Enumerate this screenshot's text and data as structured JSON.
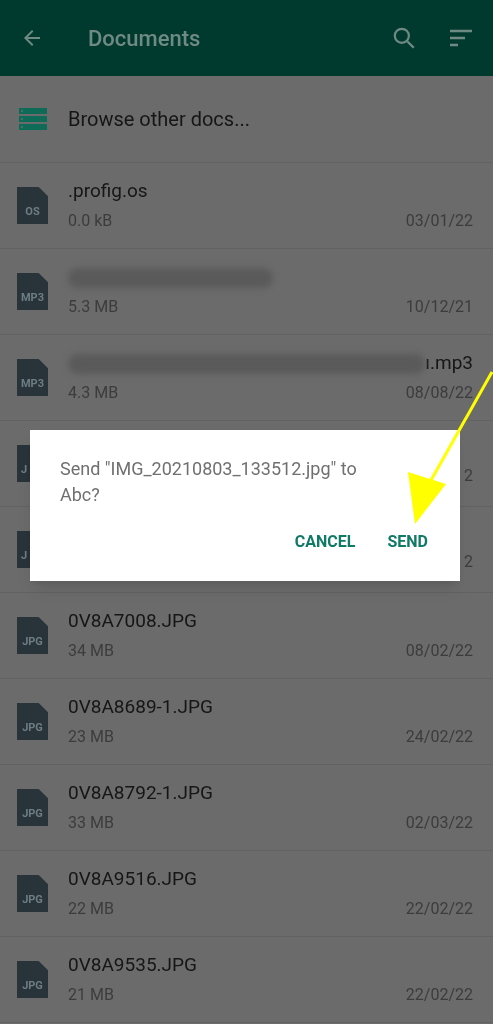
{
  "header": {
    "title": "Documents"
  },
  "browse": {
    "label": "Browse other docs..."
  },
  "files": [
    {
      "kind": "file",
      "icon_label": "OS",
      "name": ".profig.os",
      "size": "0.0 kB",
      "date": "03/01/22"
    },
    {
      "kind": "redacted",
      "icon_label": "MP3",
      "size": "5.3 MB",
      "date": "10/12/21"
    },
    {
      "kind": "redacted",
      "icon_label": "MP3",
      "name": "ı.mp3",
      "size": "4.3 MB",
      "date": "08/08/22"
    },
    {
      "kind": "covered",
      "icon_label": "J",
      "date": "2"
    },
    {
      "kind": "covered",
      "icon_label": "J",
      "date": "2"
    },
    {
      "kind": "file",
      "icon_label": "JPG",
      "name": "0V8A7008.JPG",
      "size": "34 MB",
      "date": "08/02/22"
    },
    {
      "kind": "file",
      "icon_label": "JPG",
      "name": "0V8A8689-1.JPG",
      "size": "23 MB",
      "date": "24/02/22"
    },
    {
      "kind": "file",
      "icon_label": "JPG",
      "name": "0V8A8792-1.JPG",
      "size": "33 MB",
      "date": "02/03/22"
    },
    {
      "kind": "file",
      "icon_label": "JPG",
      "name": "0V8A9516.JPG",
      "size": "22 MB",
      "date": "22/02/22"
    },
    {
      "kind": "file",
      "icon_label": "JPG",
      "name": "0V8A9535.JPG",
      "size": "21 MB",
      "date": "22/02/22"
    }
  ],
  "dialog": {
    "message": "Send \"IMG_20210803_133512.jpg\" to Abc?",
    "buttons": [
      "CANCEL",
      "SEND"
    ]
  }
}
